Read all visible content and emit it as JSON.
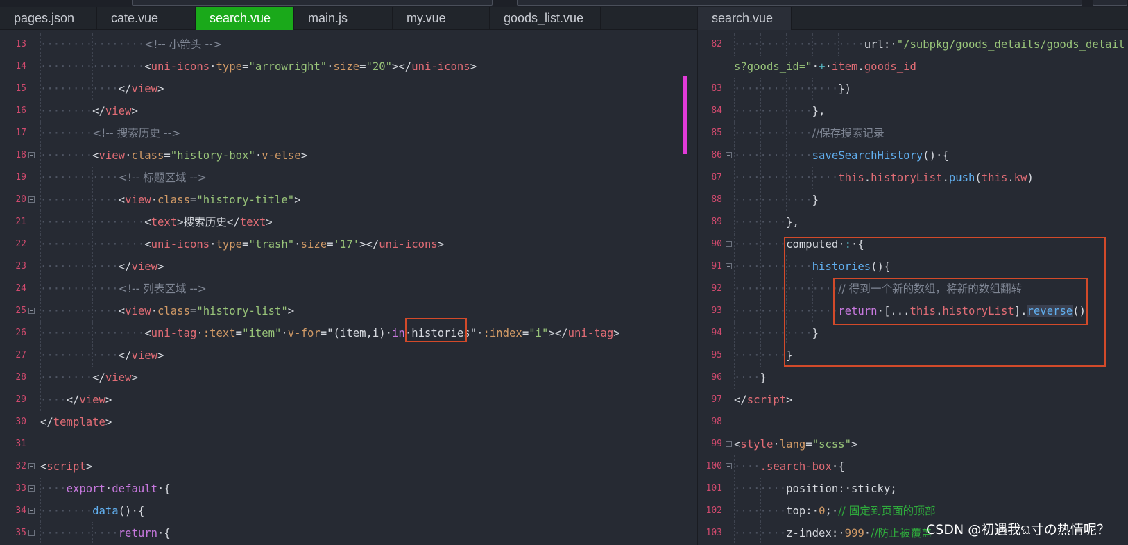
{
  "tabs_left": [
    {
      "label": "pages.json",
      "active": false
    },
    {
      "label": "cate.vue",
      "active": false
    },
    {
      "label": "search.vue",
      "active": true
    },
    {
      "label": "main.js",
      "active": false
    },
    {
      "label": "my.vue",
      "active": false
    },
    {
      "label": "goods_list.vue",
      "active": false
    }
  ],
  "tabs_right": [
    {
      "label": "search.vue",
      "active": false
    }
  ],
  "left_lines": [
    {
      "n": "13",
      "fold": false,
      "ind": 16,
      "tokens": [
        [
          "cm",
          "<!-- 小箭头 -->"
        ]
      ]
    },
    {
      "n": "14",
      "fold": false,
      "ind": 16,
      "tokens": [
        [
          "br",
          "<"
        ],
        [
          "tg",
          "uni-icons"
        ],
        [
          "br",
          " "
        ],
        [
          "at",
          "type"
        ],
        [
          "br",
          "="
        ],
        [
          "st",
          "\"arrowright\""
        ],
        [
          "br",
          " "
        ],
        [
          "at",
          "size"
        ],
        [
          "br",
          "="
        ],
        [
          "st",
          "\"20\""
        ],
        [
          "br",
          "></"
        ],
        [
          "tg",
          "uni-icons"
        ],
        [
          "br",
          ">"
        ]
      ]
    },
    {
      "n": "15",
      "fold": false,
      "ind": 12,
      "tokens": [
        [
          "br",
          "</"
        ],
        [
          "tg",
          "view"
        ],
        [
          "br",
          ">"
        ]
      ]
    },
    {
      "n": "16",
      "fold": false,
      "ind": 8,
      "tokens": [
        [
          "br",
          "</"
        ],
        [
          "tg",
          "view"
        ],
        [
          "br",
          ">"
        ]
      ]
    },
    {
      "n": "17",
      "fold": false,
      "ind": 8,
      "tokens": [
        [
          "cm",
          "<!-- 搜索历史 -->"
        ]
      ]
    },
    {
      "n": "18",
      "fold": true,
      "ind": 8,
      "tokens": [
        [
          "br",
          "<"
        ],
        [
          "tg",
          "view"
        ],
        [
          "br",
          " "
        ],
        [
          "at",
          "class"
        ],
        [
          "br",
          "="
        ],
        [
          "st",
          "\"history-box\""
        ],
        [
          "br",
          " "
        ],
        [
          "at",
          "v-else"
        ],
        [
          "br",
          ">"
        ]
      ]
    },
    {
      "n": "19",
      "fold": false,
      "ind": 12,
      "tokens": [
        [
          "cm",
          "<!-- 标题区域 -->"
        ]
      ]
    },
    {
      "n": "20",
      "fold": true,
      "ind": 12,
      "tokens": [
        [
          "br",
          "<"
        ],
        [
          "tg",
          "view"
        ],
        [
          "br",
          " "
        ],
        [
          "at",
          "class"
        ],
        [
          "br",
          "="
        ],
        [
          "st",
          "\"history-title\""
        ],
        [
          "br",
          ">"
        ]
      ]
    },
    {
      "n": "21",
      "fold": false,
      "ind": 16,
      "tokens": [
        [
          "br",
          "<"
        ],
        [
          "tg",
          "text"
        ],
        [
          "br",
          ">搜索历史</"
        ],
        [
          "tg",
          "text"
        ],
        [
          "br",
          ">"
        ]
      ]
    },
    {
      "n": "22",
      "fold": false,
      "ind": 16,
      "tokens": [
        [
          "br",
          "<"
        ],
        [
          "tg",
          "uni-icons"
        ],
        [
          "br",
          " "
        ],
        [
          "at",
          "type"
        ],
        [
          "br",
          "="
        ],
        [
          "st",
          "\"trash\""
        ],
        [
          "br",
          " "
        ],
        [
          "at",
          "size"
        ],
        [
          "br",
          "="
        ],
        [
          "st",
          "'17'"
        ],
        [
          "br",
          "></"
        ],
        [
          "tg",
          "uni-icons"
        ],
        [
          "br",
          ">"
        ]
      ]
    },
    {
      "n": "23",
      "fold": false,
      "ind": 12,
      "tokens": [
        [
          "br",
          "</"
        ],
        [
          "tg",
          "view"
        ],
        [
          "br",
          ">"
        ]
      ]
    },
    {
      "n": "24",
      "fold": false,
      "ind": 12,
      "tokens": [
        [
          "cm",
          "<!-- 列表区域 -->"
        ]
      ]
    },
    {
      "n": "25",
      "fold": true,
      "ind": 12,
      "tokens": [
        [
          "br",
          "<"
        ],
        [
          "tg",
          "view"
        ],
        [
          "br",
          " "
        ],
        [
          "at",
          "class"
        ],
        [
          "br",
          "="
        ],
        [
          "st",
          "\"history-list\""
        ],
        [
          "br",
          ">"
        ]
      ]
    },
    {
      "n": "26",
      "fold": false,
      "ind": 16,
      "tokens": [
        [
          "br",
          "<"
        ],
        [
          "tg",
          "uni-tag"
        ],
        [
          "br",
          " "
        ],
        [
          "at",
          ":text"
        ],
        [
          "br",
          "="
        ],
        [
          "st",
          "\"item\""
        ],
        [
          "br",
          " "
        ],
        [
          "at",
          "v-for"
        ],
        [
          "br",
          "="
        ],
        [
          "br",
          "\"(item,i) "
        ],
        [
          "kw",
          "in"
        ],
        [
          "br",
          " histories"
        ],
        [
          "br",
          "\""
        ],
        [
          "br",
          " "
        ],
        [
          "at",
          ":index"
        ],
        [
          "br",
          "="
        ],
        [
          "st",
          "\"i\""
        ],
        [
          "br",
          "></"
        ],
        [
          "tg",
          "uni-tag"
        ],
        [
          "br",
          ">"
        ]
      ]
    },
    {
      "n": "27",
      "fold": false,
      "ind": 12,
      "tokens": [
        [
          "br",
          "</"
        ],
        [
          "tg",
          "view"
        ],
        [
          "br",
          ">"
        ]
      ]
    },
    {
      "n": "28",
      "fold": false,
      "ind": 8,
      "tokens": [
        [
          "br",
          "</"
        ],
        [
          "tg",
          "view"
        ],
        [
          "br",
          ">"
        ]
      ]
    },
    {
      "n": "29",
      "fold": false,
      "ind": 4,
      "tokens": [
        [
          "br",
          "</"
        ],
        [
          "tg",
          "view"
        ],
        [
          "br",
          ">"
        ]
      ]
    },
    {
      "n": "30",
      "fold": false,
      "ind": 0,
      "tokens": [
        [
          "br",
          "</"
        ],
        [
          "tg",
          "template"
        ],
        [
          "br",
          ">"
        ]
      ]
    },
    {
      "n": "31",
      "fold": false,
      "ind": 0,
      "tokens": []
    },
    {
      "n": "32",
      "fold": true,
      "ind": 0,
      "tokens": [
        [
          "br",
          "<"
        ],
        [
          "tg",
          "script"
        ],
        [
          "br",
          ">"
        ]
      ]
    },
    {
      "n": "33",
      "fold": true,
      "ind": 4,
      "tokens": [
        [
          "kw",
          "export"
        ],
        [
          "br",
          " "
        ],
        [
          "kw",
          "default"
        ],
        [
          "br",
          " {"
        ]
      ]
    },
    {
      "n": "34",
      "fold": true,
      "ind": 8,
      "tokens": [
        [
          "fn",
          "data"
        ],
        [
          "br",
          "() {"
        ]
      ]
    },
    {
      "n": "35",
      "fold": true,
      "ind": 12,
      "tokens": [
        [
          "kw",
          "return"
        ],
        [
          "br",
          " {"
        ]
      ]
    }
  ],
  "right_lines": [
    {
      "n": "82",
      "fold": false,
      "ind": 20,
      "tokens": [
        [
          "br",
          "url: "
        ],
        [
          "st",
          "\"/subpkg/goods_details/goods_detail"
        ]
      ]
    },
    {
      "n": "",
      "fold": false,
      "ind": 0,
      "tokens": [
        [
          "st",
          "s?goods_id=\""
        ],
        [
          "br",
          " "
        ],
        [
          "op",
          "+"
        ],
        [
          "br",
          " "
        ],
        [
          "pr",
          "item"
        ],
        [
          "br",
          "."
        ],
        [
          "pr",
          "goods_id"
        ]
      ]
    },
    {
      "n": "83",
      "fold": false,
      "ind": 16,
      "tokens": [
        [
          "br",
          "})"
        ]
      ]
    },
    {
      "n": "84",
      "fold": false,
      "ind": 12,
      "tokens": [
        [
          "br",
          "},"
        ]
      ]
    },
    {
      "n": "85",
      "fold": false,
      "ind": 12,
      "tokens": [
        [
          "cm",
          "//保存搜索记录"
        ]
      ]
    },
    {
      "n": "86",
      "fold": true,
      "ind": 12,
      "tokens": [
        [
          "fn",
          "saveSearchHistory"
        ],
        [
          "br",
          "() {"
        ]
      ]
    },
    {
      "n": "87",
      "fold": false,
      "ind": 16,
      "tokens": [
        [
          "pr",
          "this"
        ],
        [
          "br",
          "."
        ],
        [
          "pr",
          "historyList"
        ],
        [
          "br",
          "."
        ],
        [
          "fn",
          "push"
        ],
        [
          "br",
          "("
        ],
        [
          "pr",
          "this"
        ],
        [
          "br",
          "."
        ],
        [
          "pr",
          "kw"
        ],
        [
          "br",
          ")"
        ]
      ]
    },
    {
      "n": "88",
      "fold": false,
      "ind": 12,
      "tokens": [
        [
          "br",
          "}"
        ]
      ]
    },
    {
      "n": "89",
      "fold": false,
      "ind": 8,
      "tokens": [
        [
          "br",
          "},"
        ]
      ]
    },
    {
      "n": "90",
      "fold": true,
      "ind": 8,
      "tokens": [
        [
          "br",
          "computed "
        ],
        [
          "op",
          ":"
        ],
        [
          "br",
          " {"
        ]
      ]
    },
    {
      "n": "91",
      "fold": true,
      "ind": 12,
      "tokens": [
        [
          "fn",
          "histories"
        ],
        [
          "br",
          "(){"
        ]
      ]
    },
    {
      "n": "92",
      "fold": false,
      "ind": 16,
      "tokens": [
        [
          "cm",
          "// 得到一个新的数组，将新的数组翻转"
        ]
      ]
    },
    {
      "n": "93",
      "fold": false,
      "ind": 16,
      "tokens": [
        [
          "kw",
          "return"
        ],
        [
          "br",
          " [..."
        ],
        [
          "pr",
          "this"
        ],
        [
          "br",
          "."
        ],
        [
          "pr",
          "historyList"
        ],
        [
          "br",
          "]."
        ],
        [
          "fnh",
          "reverse"
        ],
        [
          "br",
          "()"
        ]
      ]
    },
    {
      "n": "94",
      "fold": false,
      "ind": 12,
      "tokens": [
        [
          "br",
          "}"
        ]
      ]
    },
    {
      "n": "95",
      "fold": false,
      "ind": 8,
      "tokens": [
        [
          "br",
          "}"
        ]
      ]
    },
    {
      "n": "96",
      "fold": false,
      "ind": 4,
      "tokens": [
        [
          "br",
          "}"
        ]
      ]
    },
    {
      "n": "97",
      "fold": false,
      "ind": 0,
      "tokens": [
        [
          "br",
          "</"
        ],
        [
          "tg",
          "script"
        ],
        [
          "br",
          ">"
        ]
      ]
    },
    {
      "n": "98",
      "fold": false,
      "ind": 0,
      "tokens": []
    },
    {
      "n": "99",
      "fold": true,
      "ind": 0,
      "tokens": [
        [
          "br",
          "<"
        ],
        [
          "tg",
          "style"
        ],
        [
          "br",
          " "
        ],
        [
          "at",
          "lang"
        ],
        [
          "br",
          "="
        ],
        [
          "st",
          "\"scss\""
        ],
        [
          "br",
          ">"
        ]
      ]
    },
    {
      "n": "100",
      "fold": true,
      "ind": 4,
      "tokens": [
        [
          "tg",
          ".search-box"
        ],
        [
          "br",
          " {"
        ]
      ]
    },
    {
      "n": "101",
      "fold": false,
      "ind": 8,
      "tokens": [
        [
          "br",
          "position: sticky;"
        ]
      ]
    },
    {
      "n": "102",
      "fold": false,
      "ind": 8,
      "tokens": [
        [
          "br",
          "top: "
        ],
        [
          "nm",
          "0"
        ],
        [
          "br",
          "; "
        ],
        [
          "cmg",
          "// 固定到页面的顶部"
        ]
      ]
    },
    {
      "n": "103",
      "fold": false,
      "ind": 8,
      "tokens": [
        [
          "br",
          "z-index: "
        ],
        [
          "nm",
          "999"
        ],
        [
          "br",
          " "
        ],
        [
          "cmg",
          "//防止被覆盖"
        ]
      ]
    }
  ],
  "watermark": "CSDN @初遇我ଘ寸の热情呢？"
}
